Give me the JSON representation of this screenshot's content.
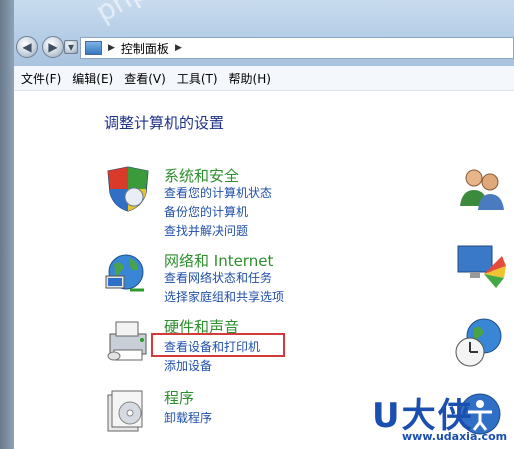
{
  "address_bar": {
    "path": "控制面板"
  },
  "menu": [
    "文件(F)",
    "编辑(E)",
    "查看(V)",
    "工具(T)",
    "帮助(H)"
  ],
  "heading": "调整计算机的设置",
  "categories": [
    {
      "title": "系统和安全",
      "links": [
        "查看您的计算机状态",
        "备份您的计算机",
        "查找并解决问题"
      ],
      "icon": "shield-icon"
    },
    {
      "title": "网络和 Internet",
      "links": [
        "查看网络状态和任务",
        "选择家庭组和共享选项"
      ],
      "icon": "network-globe-icon"
    },
    {
      "title": "硬件和声音",
      "links": [
        "查看设备和打印机",
        "添加设备"
      ],
      "icon": "printer-icon"
    },
    {
      "title": "程序",
      "links": [
        "卸载程序"
      ],
      "icon": "programs-icon"
    }
  ],
  "right_icons": [
    "user-accounts-icon",
    "appearance-icon",
    "clock-globe-icon",
    "ease-of-access-icon"
  ],
  "watermark": {
    "brand": "U大侠",
    "url": "www.udaxia.com",
    "overlay": "php.cn"
  },
  "colors": {
    "category_title": "#2d8f2d",
    "link": "#1f4fa8",
    "highlight_border": "#d33a3a",
    "heading": "#1e3287"
  }
}
